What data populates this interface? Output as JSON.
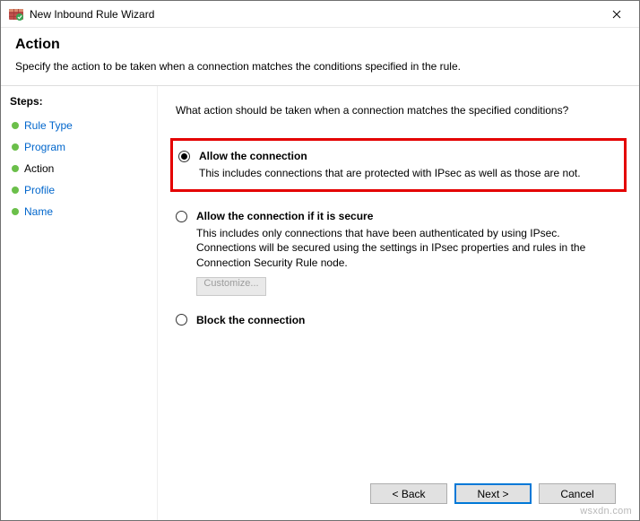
{
  "window": {
    "title": "New Inbound Rule Wizard"
  },
  "header": {
    "heading": "Action",
    "subheading": "Specify the action to be taken when a connection matches the conditions specified in the rule."
  },
  "steps": {
    "title": "Steps:",
    "items": [
      {
        "label": "Rule Type",
        "active": false
      },
      {
        "label": "Program",
        "active": false
      },
      {
        "label": "Action",
        "active": true
      },
      {
        "label": "Profile",
        "active": false
      },
      {
        "label": "Name",
        "active": false
      }
    ]
  },
  "content": {
    "prompt": "What action should be taken when a connection matches the specified conditions?",
    "options": {
      "allow": {
        "label": "Allow the connection",
        "desc": "This includes connections that are protected with IPsec as well as those are not."
      },
      "allow_secure": {
        "label": "Allow the connection if it is secure",
        "desc": "This includes only connections that have been authenticated by using IPsec. Connections will be secured using the settings in IPsec properties and rules in the Connection Security Rule node.",
        "customize": "Customize..."
      },
      "block": {
        "label": "Block the connection"
      }
    }
  },
  "buttons": {
    "back": "< Back",
    "next": "Next >",
    "cancel": "Cancel"
  },
  "watermark": "wsxdn.com"
}
